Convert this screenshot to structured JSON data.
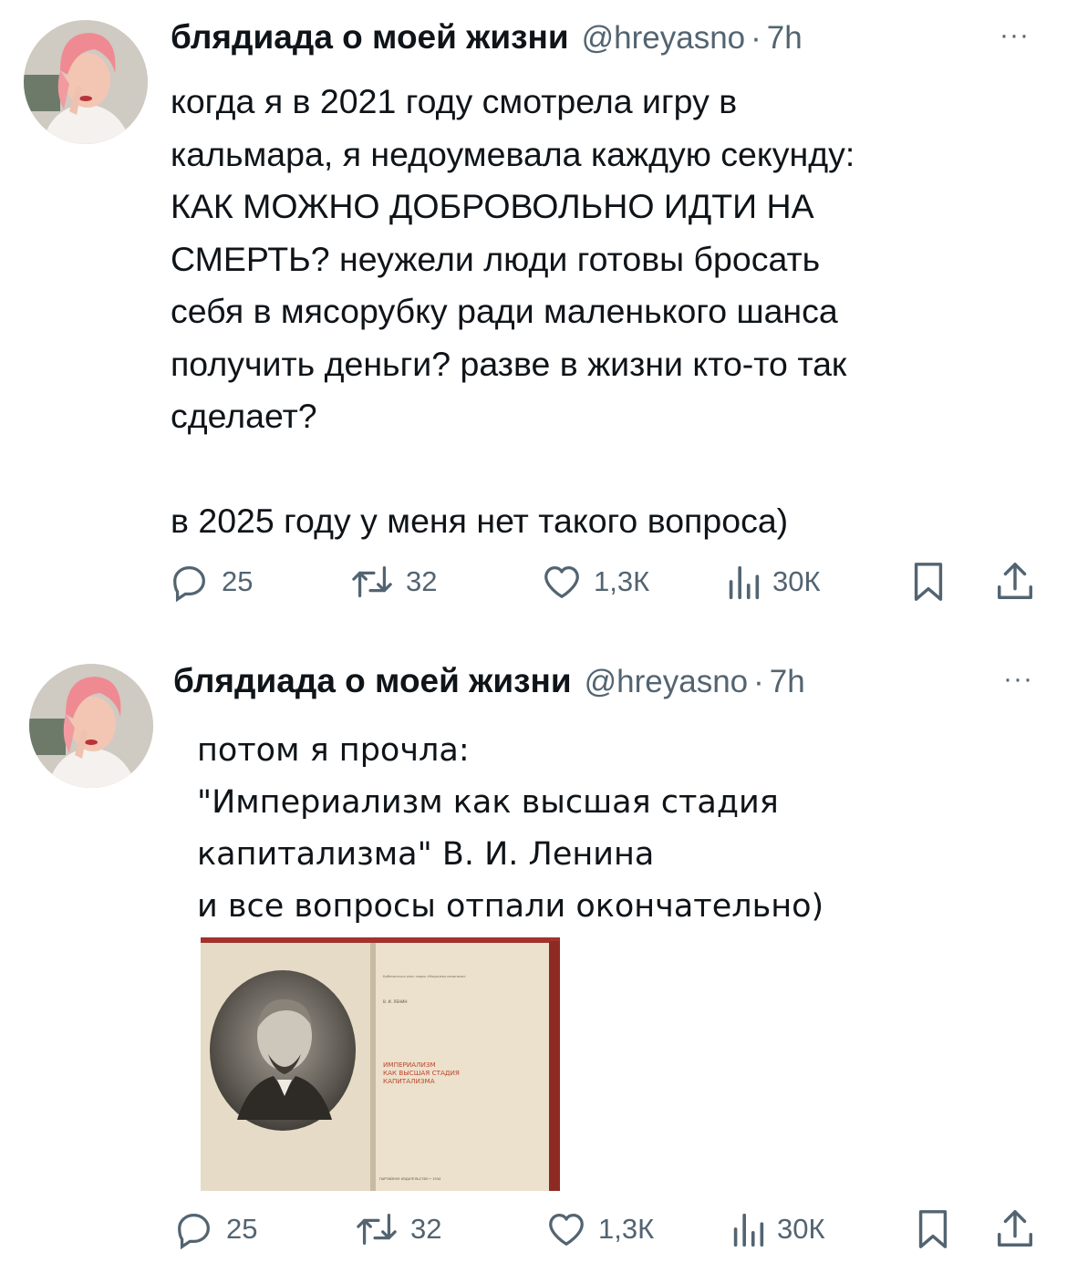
{
  "tweets": [
    {
      "author_name": "блядиада о моей жизни",
      "handle": "@hreyasno",
      "separator": "·",
      "time": "7h",
      "more": "···",
      "text_lines": [
        "когда я в 2021 году смотрела игру в",
        "кальмара, я недоумевала каждую секунду:",
        "КАК МОЖНО ДОБРОВОЛЬНО ИДТИ НА",
        "СМЕРТЬ?  неужели люди готовы бросать",
        "себя в мясорубку ради маленького шанса",
        "получить деньги? разве в жизни кто-то так",
        "сделает?"
      ],
      "text_after": "в 2025 году у меня нет такого вопроса)",
      "stats": {
        "replies": "25",
        "reposts": "32",
        "likes": "1,3К",
        "views": "30К"
      }
    },
    {
      "author_name": "блядиада о моей жизни",
      "handle": "@hreyasno",
      "separator": "·",
      "time": "7h",
      "more": "···",
      "text_lines": [
        "потом я прочла:",
        "\"Империализм как высшая стадия",
        "капитализма\" В. И. Ленина",
        "и все вопросы отпали окончательно)"
      ],
      "image": {
        "book_series": "Библиотечка книг серии «Марксизм-ленинизм»",
        "book_author": "В. И. ЛЕНИН",
        "book_title_lines": [
          "ИМПЕРИАЛИЗМ",
          "КАК ВЫСШАЯ СТАДИЯ",
          "КАПИТАЛИЗМА"
        ],
        "book_publisher": "ПАРТИЙНОЕ ИЗДАТЕЛЬСТВО • 1934"
      },
      "stats": {
        "replies": "25",
        "reposts": "32",
        "likes": "1,3К",
        "views": "30К"
      }
    }
  ],
  "colors": {
    "text": "#0f1419",
    "secondary": "#536471",
    "book_title_red": "#c0462e"
  },
  "icons": [
    "reply-icon",
    "repost-icon",
    "like-icon",
    "views-icon",
    "bookmark-icon",
    "share-icon"
  ]
}
